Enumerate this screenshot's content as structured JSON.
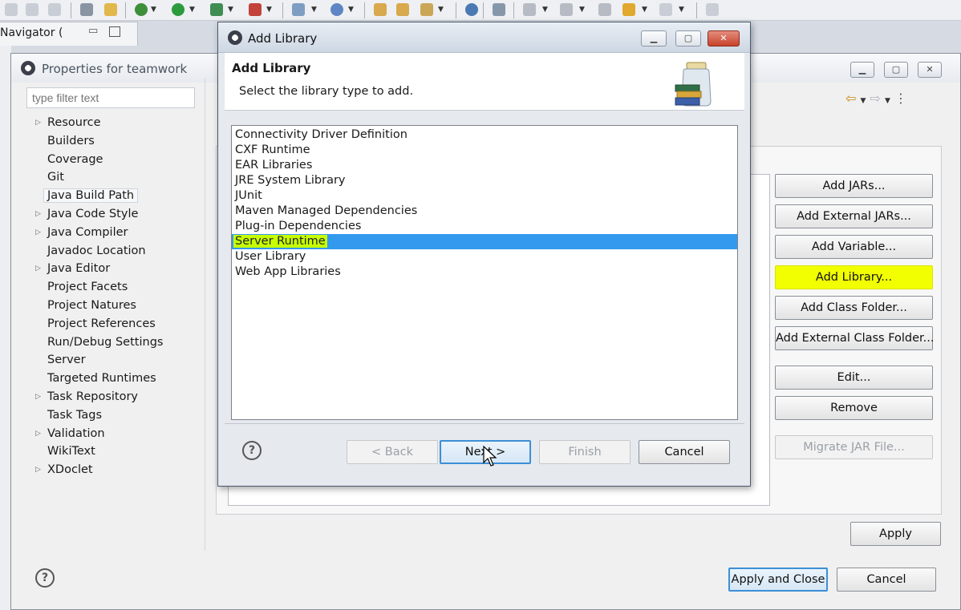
{
  "navigator": {
    "tab_label": "Navigator ("
  },
  "properties": {
    "title": "Properties for teamwork",
    "filter_placeholder": "type filter text",
    "tree": [
      {
        "label": "Resource",
        "expandable": true
      },
      {
        "label": "Builders",
        "expandable": false
      },
      {
        "label": "Coverage",
        "expandable": false
      },
      {
        "label": "Git",
        "expandable": false
      },
      {
        "label": "Java Build Path",
        "expandable": false,
        "selected": true
      },
      {
        "label": "Java Code Style",
        "expandable": true
      },
      {
        "label": "Java Compiler",
        "expandable": true
      },
      {
        "label": "Javadoc Location",
        "expandable": false
      },
      {
        "label": "Java Editor",
        "expandable": true
      },
      {
        "label": "Project Facets",
        "expandable": false
      },
      {
        "label": "Project Natures",
        "expandable": false
      },
      {
        "label": "Project References",
        "expandable": false
      },
      {
        "label": "Run/Debug Settings",
        "expandable": false
      },
      {
        "label": "Server",
        "expandable": false
      },
      {
        "label": "Targeted Runtimes",
        "expandable": false
      },
      {
        "label": "Task Repository",
        "expandable": true
      },
      {
        "label": "Task Tags",
        "expandable": false
      },
      {
        "label": "Validation",
        "expandable": true
      },
      {
        "label": "WikiText",
        "expandable": false
      },
      {
        "label": "XDoclet",
        "expandable": true
      }
    ],
    "buttons": {
      "add_jars": "Add JARs...",
      "add_external_jars": "Add External JARs...",
      "add_variable": "Add Variable...",
      "add_library": "Add Library...",
      "add_class_folder": "Add Class Folder...",
      "add_external_class_folder": "Add External Class Folder...",
      "edit": "Edit...",
      "remove": "Remove",
      "migrate_jar": "Migrate JAR File...",
      "apply": "Apply",
      "apply_and_close": "Apply and Close",
      "cancel": "Cancel"
    },
    "help": "?"
  },
  "add_library": {
    "title": "Add Library",
    "heading": "Add Library",
    "subtitle": "Select the library type to add.",
    "items": [
      "Connectivity Driver Definition",
      "CXF Runtime",
      "EAR Libraries",
      "JRE System Library",
      "JUnit",
      "Maven Managed Dependencies",
      "Plug-in Dependencies",
      "Server Runtime",
      "User Library",
      "Web App Libraries"
    ],
    "selected_index": 7,
    "buttons": {
      "back": "< Back",
      "next": "Next >",
      "finish": "Finish",
      "cancel": "Cancel"
    },
    "help": "?"
  },
  "colors": {
    "selection": "#3399ee",
    "highlight": "#f1ff00",
    "default_button_border": "#3c8fd6"
  }
}
